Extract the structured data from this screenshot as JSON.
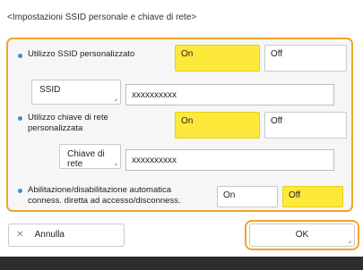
{
  "header": {
    "title": "<Impostazioni SSID personale e chiave di rete>"
  },
  "settings": {
    "ssid_custom": {
      "label": "Utilizzo SSID personalizzato",
      "on_label": "On",
      "off_label": "Off",
      "selected": "On"
    },
    "ssid": {
      "button_label": "SSID",
      "value": "xxxxxxxxxx"
    },
    "network_key_custom": {
      "label_line1": "Utilizzo chiave di rete",
      "label_line2": "personalizzata",
      "on_label": "On",
      "off_label": "Off",
      "selected": "On"
    },
    "network_key": {
      "button_label": "Chiave di rete",
      "value": "xxxxxxxxxx"
    },
    "auto_toggle": {
      "label_line1": "Abilitazione/disabilitazione automatica",
      "label_line2": "conness. diretta ad accesso/disconness.",
      "on_label": "On",
      "off_label": "Off",
      "selected": "Off"
    }
  },
  "actions": {
    "cancel_label": "Annulla",
    "ok_label": "OK"
  },
  "icons": {
    "cancel": "x-icon",
    "edit_corner": "corner-arrow-icon"
  },
  "colors": {
    "accent": "#f0a52a",
    "selected": "#fde93a",
    "bullet": "#3a8fd1"
  }
}
